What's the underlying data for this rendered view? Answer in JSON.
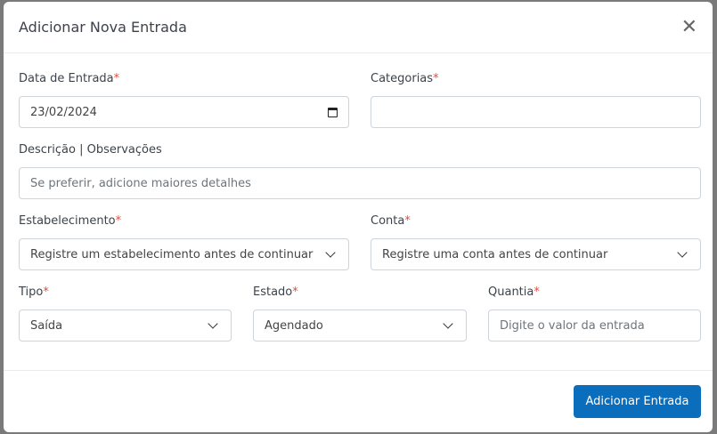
{
  "modal": {
    "title": "Adicionar Nova Entrada",
    "close_icon": "close-icon"
  },
  "fields": {
    "date": {
      "label": "Data de Entrada",
      "required": "*",
      "value": "23/02/2024"
    },
    "categories": {
      "label": "Categorias",
      "required": "*",
      "value": ""
    },
    "description": {
      "label": "Descrição | Observações",
      "placeholder": "Se preferir, adicione maiores detalhes"
    },
    "establishment": {
      "label": "Estabelecimento",
      "required": "*",
      "value": "Registre um estabelecimento antes de continuar"
    },
    "account": {
      "label": "Conta",
      "required": "*",
      "value": "Registre uma conta antes de continuar"
    },
    "type": {
      "label": "Tipo",
      "required": "*",
      "value": "Saída"
    },
    "status": {
      "label": "Estado",
      "required": "*",
      "value": "Agendado"
    },
    "amount": {
      "label": "Quantia",
      "required": "*",
      "placeholder": "Digite o valor da entrada"
    }
  },
  "footer": {
    "submit_label": "Adicionar Entrada"
  },
  "colors": {
    "primary": "#0b6ebd",
    "required": "#e74c3c"
  }
}
